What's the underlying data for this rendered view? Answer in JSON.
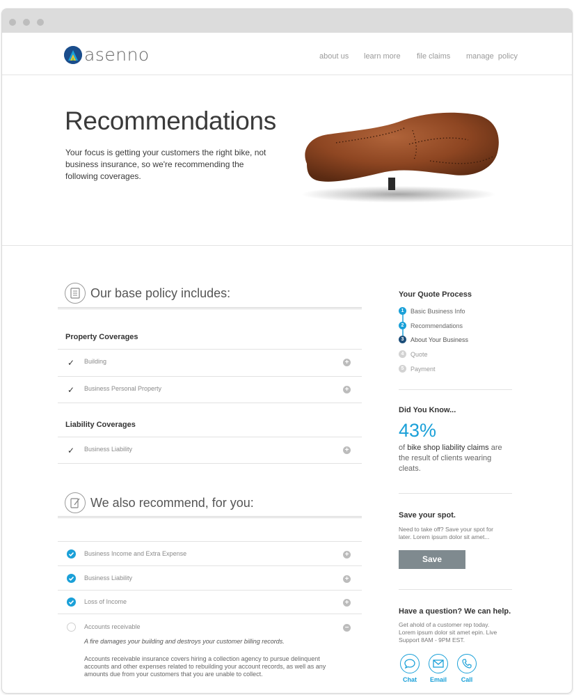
{
  "brand": {
    "name": "asenno"
  },
  "nav": [
    "about us",
    "learn more",
    "file claims",
    "manage  policy"
  ],
  "hero": {
    "title": "Recommendations",
    "body": "Your focus is getting your customers the right bike, not business insurance, so we're recommending the following coverages."
  },
  "base_policy": {
    "title": "Our base policy includes:",
    "icon": "document-icon",
    "property": {
      "heading": "Property Coverages",
      "items": [
        "Building",
        "Business Personal Property"
      ]
    },
    "liability": {
      "heading": "Liability Coverages",
      "items": [
        "Business Liability"
      ]
    }
  },
  "recommend": {
    "title": "We also recommend, for you:",
    "icon": "pencil-note-icon",
    "items": [
      {
        "label": "Business Income and Extra Expense",
        "checked": true
      },
      {
        "label": "Business Liability",
        "checked": true
      },
      {
        "label": "Loss of Income",
        "checked": true
      },
      {
        "label": "Accounts receivable",
        "checked": false
      }
    ],
    "expanded": {
      "example": "A fire damages your building and destroys your customer billing records.",
      "description": "Accounts receivable insurance covers hiring a collection agency to pursue delinquent accounts and other expenses related to rebuilding your account records, as well as any amounts due from your customers that you are unable to collect."
    }
  },
  "quote_process": {
    "title": "Your Quote Process",
    "steps": [
      {
        "num": "1",
        "label": "Basic Business Info"
      },
      {
        "num": "2",
        "label": "Recommendations"
      },
      {
        "num": "3",
        "label": "About Your Business"
      },
      {
        "num": "4",
        "label": "Quote"
      },
      {
        "num": "5",
        "label": "Payment"
      }
    ]
  },
  "did_you_know": {
    "title": "Did You Know...",
    "stat": "43%",
    "text_bold": "bike shop liability claims",
    "text_pre": "of",
    "text_post": "are the result of clients wearing cleats."
  },
  "save": {
    "title": "Save your spot.",
    "body": "Need to take off? Save your spot for later. Lorem ipsum dolor sit amet...",
    "button": "Save"
  },
  "help": {
    "title": "Have a question? We can help.",
    "body": "Get ahold of a customer rep today. Lorem ipsum dolor sit amet epin. Live Support 8AM - 9PM EST.",
    "contacts": [
      {
        "label": "Chat",
        "icon": "chat-bubble-icon"
      },
      {
        "label": "Email",
        "icon": "envelope-icon"
      },
      {
        "label": "Call",
        "icon": "phone-icon"
      }
    ]
  },
  "colors": {
    "accent": "#1aa0d8",
    "step_done": "#1aa0d8",
    "step_current": "#1d4f7a",
    "step_todo": "#d3d3d3",
    "save_button": "#7f8a8f"
  }
}
